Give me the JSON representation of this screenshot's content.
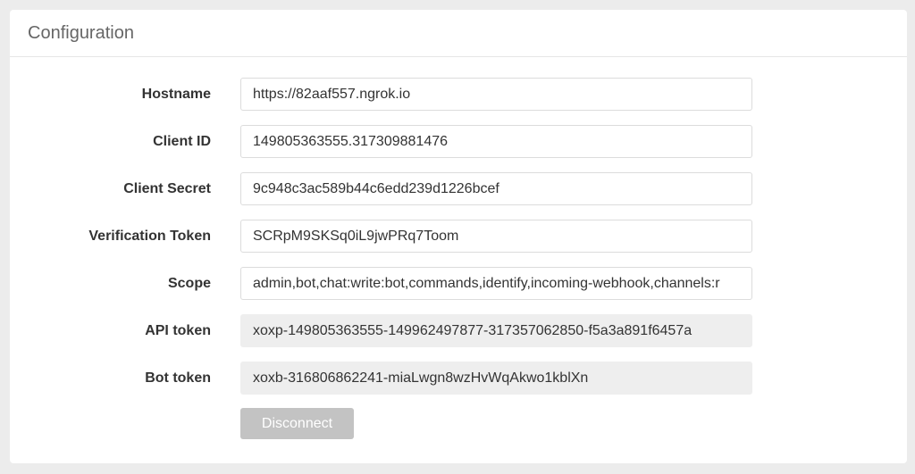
{
  "panel": {
    "title": "Configuration"
  },
  "fields": [
    {
      "label": "Hostname",
      "value": "https://82aaf557.ngrok.io",
      "readonly": false
    },
    {
      "label": "Client ID",
      "value": "149805363555.317309881476",
      "readonly": false
    },
    {
      "label": "Client Secret",
      "value": "9c948c3ac589b44c6edd239d1226bcef",
      "readonly": false
    },
    {
      "label": "Verification Token",
      "value": "SCRpM9SKSq0iL9jwPRq7Toom",
      "readonly": false
    },
    {
      "label": "Scope",
      "value": "admin,bot,chat:write:bot,commands,identify,incoming-webhook,channels:r",
      "readonly": false
    },
    {
      "label": "API token",
      "value": "xoxp-149805363555-149962497877-317357062850-f5a3a891f6457a",
      "readonly": true
    },
    {
      "label": "Bot token",
      "value": "xoxb-316806862241-miaLwgn8wzHvWqAkwo1kblXn",
      "readonly": true
    }
  ],
  "actions": {
    "disconnect_label": "Disconnect"
  },
  "colors": {
    "page_background": "#ececec",
    "panel_background": "#ffffff",
    "readonly_field_background": "#eeeeee",
    "disabled_button": "#c3c3c3"
  }
}
